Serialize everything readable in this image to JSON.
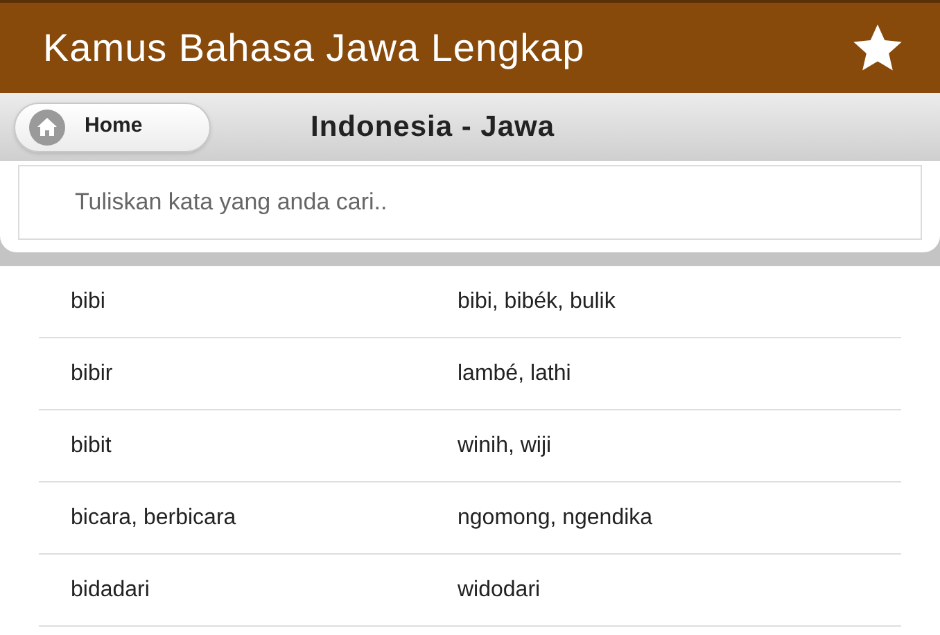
{
  "app_bar": {
    "title": "Kamus Bahasa Jawa Lengkap"
  },
  "toolbar": {
    "home_button": "Home",
    "title": "Indonesia - Jawa"
  },
  "search": {
    "placeholder": "Tuliskan kata yang anda cari.."
  },
  "entries": [
    {
      "word": "bibi",
      "translation": "bibi, bibék, bulik"
    },
    {
      "word": "bibir",
      "translation": "lambé, lathi"
    },
    {
      "word": "bibit",
      "translation": "winih, wiji"
    },
    {
      "word": "bicara, berbicara",
      "translation": "ngomong, ngendika"
    },
    {
      "word": "bidadari",
      "translation": "widodari"
    }
  ]
}
